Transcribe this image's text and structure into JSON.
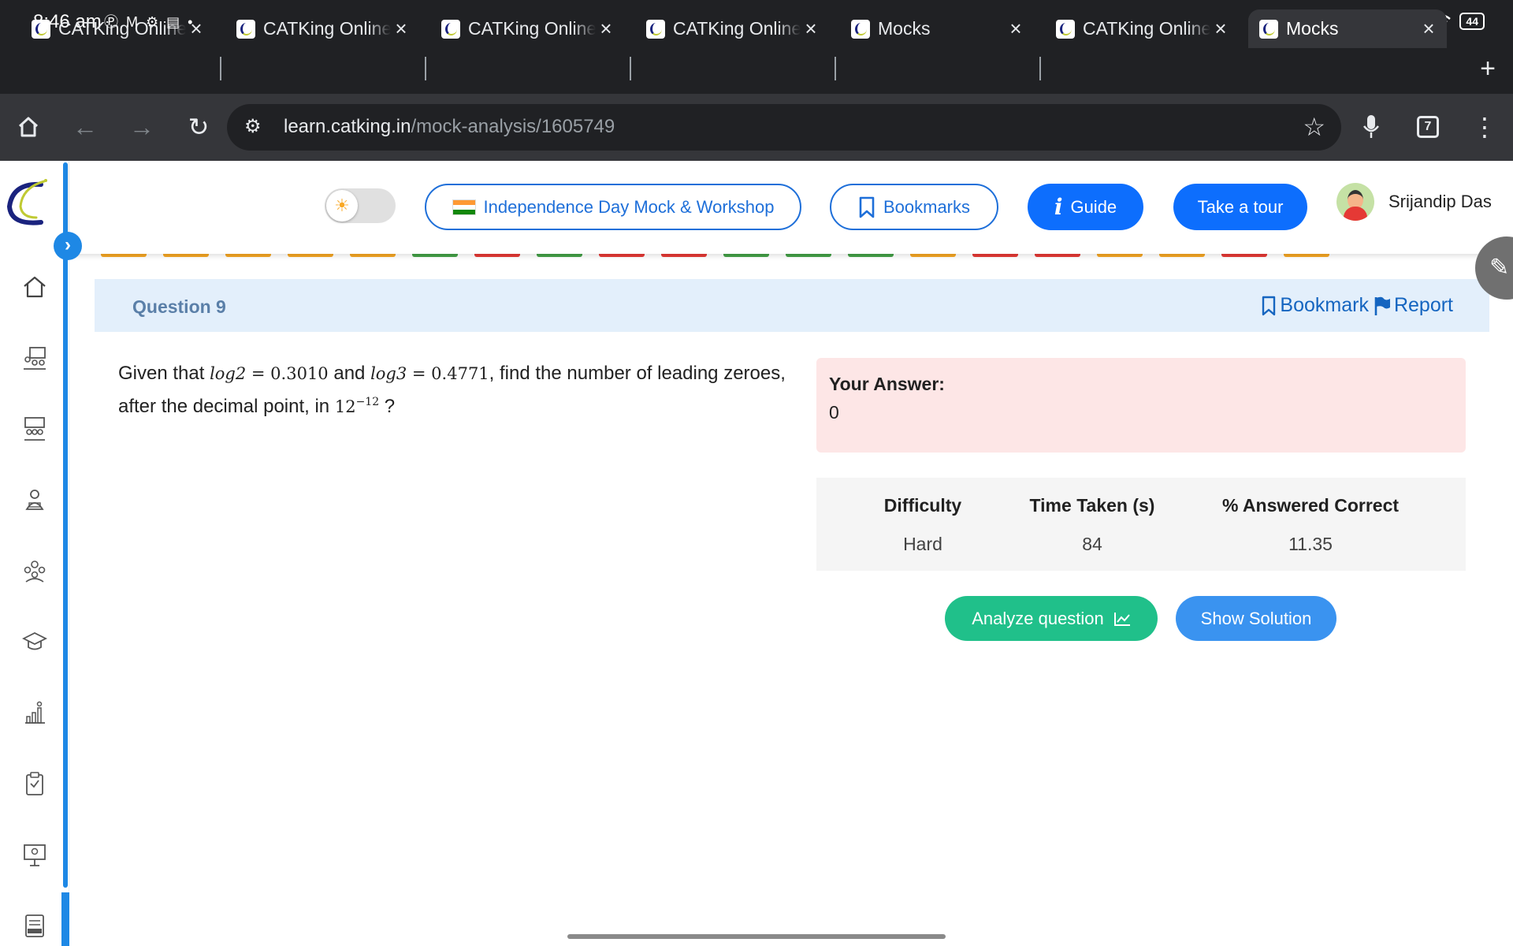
{
  "status_bar": {
    "time": "8:46 am",
    "battery": "44",
    "notification_icons": [
      "pinterest-icon",
      "gmail-icon",
      "settings-icon",
      "news-icon",
      "dot-icon"
    ]
  },
  "browser": {
    "tabs": [
      {
        "label": "CATKing Online Exam",
        "active": false
      },
      {
        "label": "CATKing Online Exam",
        "active": false
      },
      {
        "label": "CATKing Online Exam",
        "active": false
      },
      {
        "label": "CATKing Online Exam",
        "active": false
      },
      {
        "label": "Mocks",
        "active": false
      },
      {
        "label": "CATKing Online Exam",
        "active": false
      },
      {
        "label": "Mocks",
        "active": true
      }
    ],
    "url_domain": "learn.catking.in",
    "url_path": "/mock-analysis/1605749",
    "tab_count": "7"
  },
  "topbar": {
    "promo_label": "Independence Day Mock & Workshop",
    "bookmarks_label": "Bookmarks",
    "guide_label": "Guide",
    "tour_label": "Take a tour",
    "user_name": "Srijandip Das"
  },
  "question_strip_colors": [
    "#f5a623",
    "#f5a623",
    "#f5a623",
    "#f5a623",
    "#f5a623",
    "#43a047",
    "#e53935",
    "#43a047",
    "#e53935",
    "#e53935",
    "#43a047",
    "#43a047",
    "#43a047",
    "#f5a623",
    "#e53935",
    "#e53935",
    "#f5a623",
    "#f5a623",
    "#e53935",
    "#f5a623"
  ],
  "question": {
    "title": "Question 9",
    "bookmark_label": "Bookmark",
    "report_label": "Report",
    "text_1": "Given that ",
    "math_1_fn": "log2",
    "math_1_rest": " = 0.3010",
    "text_2": " and ",
    "math_2_fn": "log3",
    "math_2_rest": " = 0.4771",
    "text_3": ", find the number of leading zeroes, after the decimal point, in ",
    "math_3_base": "12",
    "math_3_exp": "−12",
    "text_4": " ?"
  },
  "answer": {
    "label": "Your Answer:",
    "value": "0"
  },
  "stats": {
    "difficulty_label": "Difficulty",
    "difficulty_value": "Hard",
    "time_label": "Time Taken (s)",
    "time_value": "84",
    "correct_label": "% Answered Correct",
    "correct_value": "11.35"
  },
  "actions": {
    "analyze_label": "Analyze question",
    "solution_label": "Show Solution"
  },
  "colors": {
    "primary": "#0d6efd",
    "analyze": "#20c08a",
    "solution": "#3a93f0",
    "answer_bg": "#fde6e6",
    "header_bg": "#e3effb"
  }
}
